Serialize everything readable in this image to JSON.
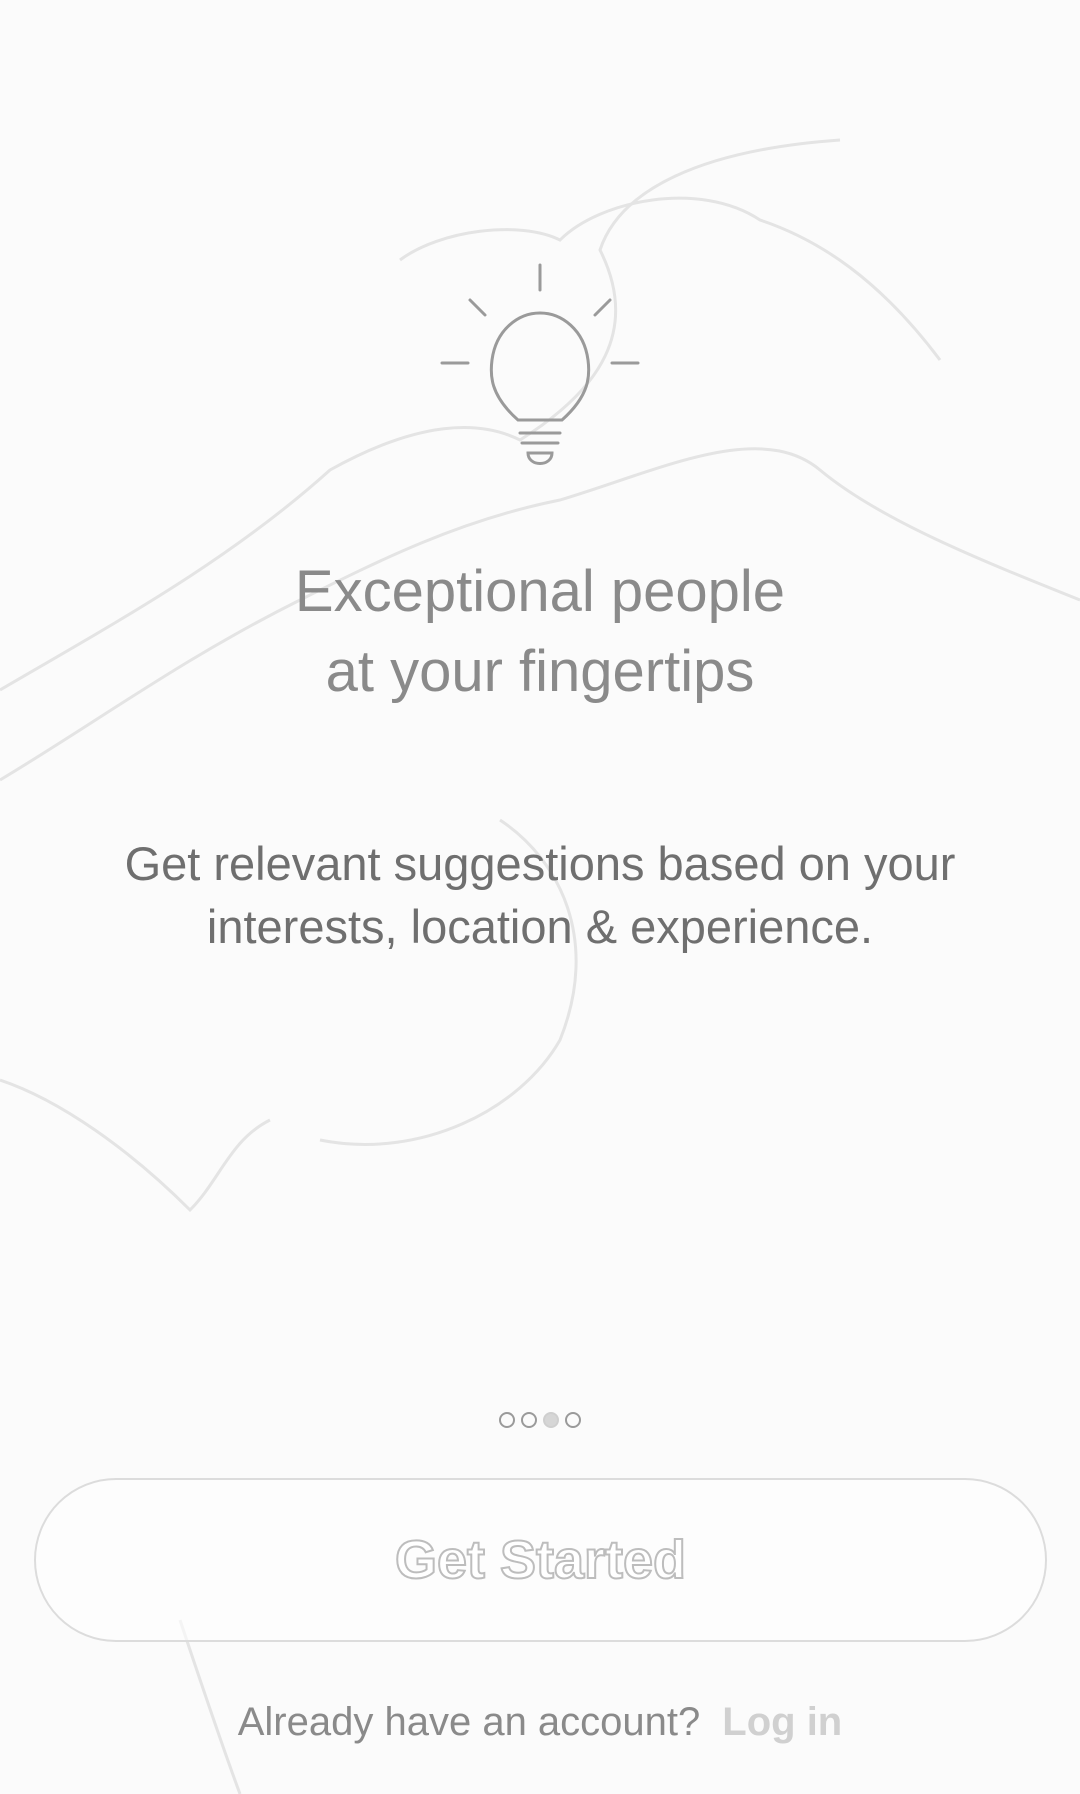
{
  "onboarding": {
    "icon": "lightbulb-icon",
    "headline_line1": "Exceptional people",
    "headline_line2": "at your fingertips",
    "body_line1": "Get relevant suggestions based on your",
    "body_line2": "interests, location & experience.",
    "page_count": 4,
    "active_page": 3
  },
  "actions": {
    "get_started_label": "Get Started",
    "account_prompt": "Already have an account?",
    "login_label": "Log in"
  }
}
